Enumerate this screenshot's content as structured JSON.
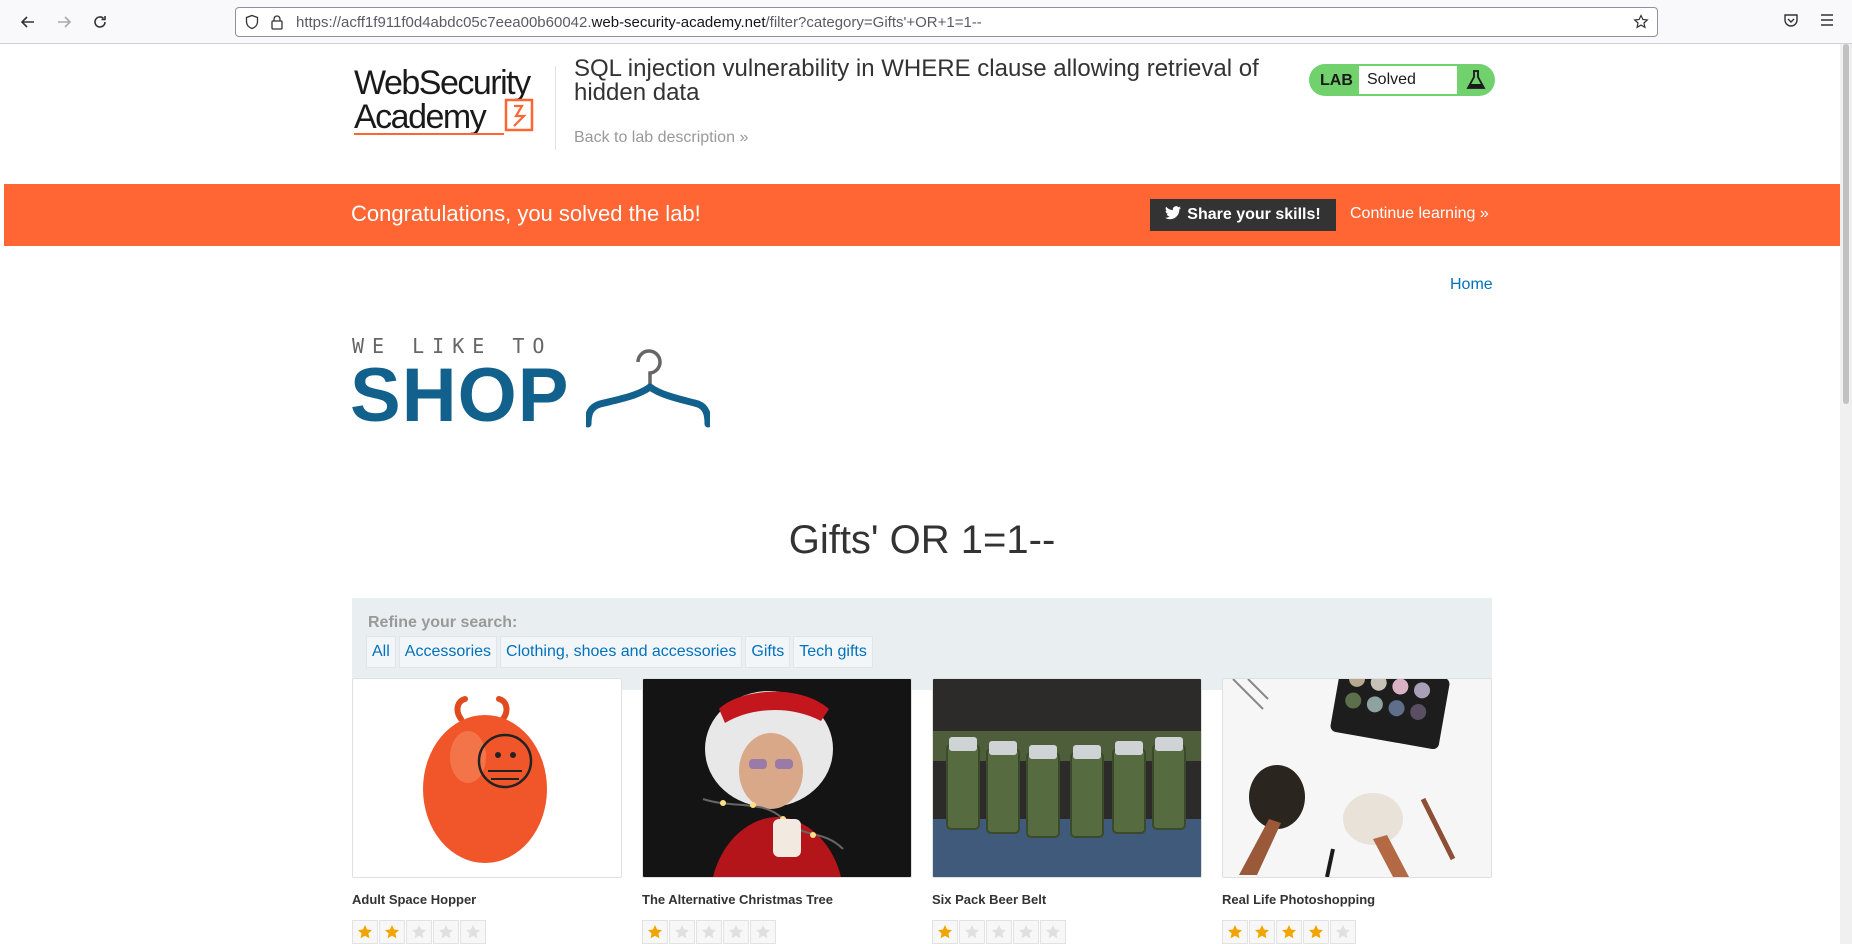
{
  "browser": {
    "url_prefix": "https://acff1f911f0d4abdc05c7eea00b60042.",
    "url_domain": "web-security-academy.net",
    "url_path": "/filter?category=Gifts'+OR+1=1--"
  },
  "academy": {
    "logo_line1": "WebSecurity",
    "logo_line2": "Academy",
    "lab_title": "SQL injection vulnerability in WHERE clause allowing retrieval of hidden data",
    "back_link": "Back to lab description",
    "lab_badge": "LAB",
    "lab_status": "Solved",
    "status_color": "#70d16d"
  },
  "banner": {
    "message": "Congratulations, you solved the lab!",
    "share_label": "Share your skills!",
    "continue_label": "Continue learning",
    "color": "#ff6633"
  },
  "nav": {
    "home_label": "Home"
  },
  "shop": {
    "tagline": "WE LIKE TO",
    "name": "SHOP",
    "brand_color": "#12608c"
  },
  "category_heading": "Gifts' OR 1=1--",
  "filters": {
    "label": "Refine your search:",
    "links": [
      "All",
      "Accessories",
      "Clothing, shoes and accessories",
      "Gifts",
      "Tech gifts"
    ]
  },
  "products": [
    {
      "name": "Adult Space Hopper",
      "rating": 2,
      "image": "orange-space-hopper"
    },
    {
      "name": "The Alternative Christmas Tree",
      "rating": 1,
      "image": "man-in-fairy-lights"
    },
    {
      "name": "Six Pack Beer Belt",
      "rating": 1,
      "image": "beer-belt"
    },
    {
      "name": "Real Life Photoshopping",
      "rating": 4,
      "image": "makeup-brushes"
    }
  ],
  "rating_max": 5
}
